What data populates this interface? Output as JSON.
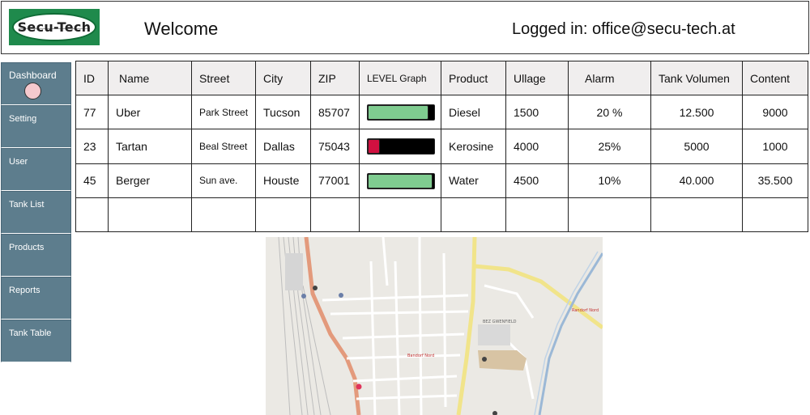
{
  "header": {
    "logo_text": "Secu-Tech",
    "welcome": "Welcome",
    "logged_in": "Logged in: office@secu-tech.at"
  },
  "sidebar": {
    "items": [
      {
        "label": "Dashboard"
      },
      {
        "label": "Setting"
      },
      {
        "label": "User"
      },
      {
        "label": "Tank List"
      },
      {
        "label": "Products"
      },
      {
        "label": "Reports"
      },
      {
        "label": "Tank Table"
      }
    ]
  },
  "table": {
    "headers": [
      "ID",
      "Name",
      "Street",
      "City",
      "ZIP",
      "LEVEL Graph",
      "Product",
      "Ullage",
      "Alarm",
      "Tank Volumen",
      "Content"
    ],
    "rows": [
      {
        "id": "77",
        "name": "Uber",
        "street": "Park Street",
        "city": "Tucson",
        "zip": "85707",
        "level": 0.92,
        "level_color": "#7fcc90",
        "product": "Diesel",
        "ullage": "1500",
        "alarm": "20 %",
        "volume": "12.500",
        "content": "9000"
      },
      {
        "id": "23",
        "name": "Tartan",
        "street": "Beal Street",
        "city": "Dallas",
        "zip": "75043",
        "level": 0.18,
        "level_color": "#d01040",
        "product": "Kerosine",
        "ullage": "4000",
        "alarm": "25%",
        "volume": "5000",
        "content": "1000"
      },
      {
        "id": "45",
        "name": "Berger",
        "street": "Sun ave.",
        "city": "Houste",
        "zip": "77001",
        "level": 0.98,
        "level_color": "#7fcc90",
        "product": "Water",
        "ullage": "4500",
        "alarm": "10%",
        "volume": "40.000",
        "content": "35.500"
      }
    ]
  },
  "map": {
    "labels": {
      "park": "BEZ GWENFIELD",
      "nord": "Randorf Nord",
      "nord2": "Bandorf Nord"
    }
  }
}
